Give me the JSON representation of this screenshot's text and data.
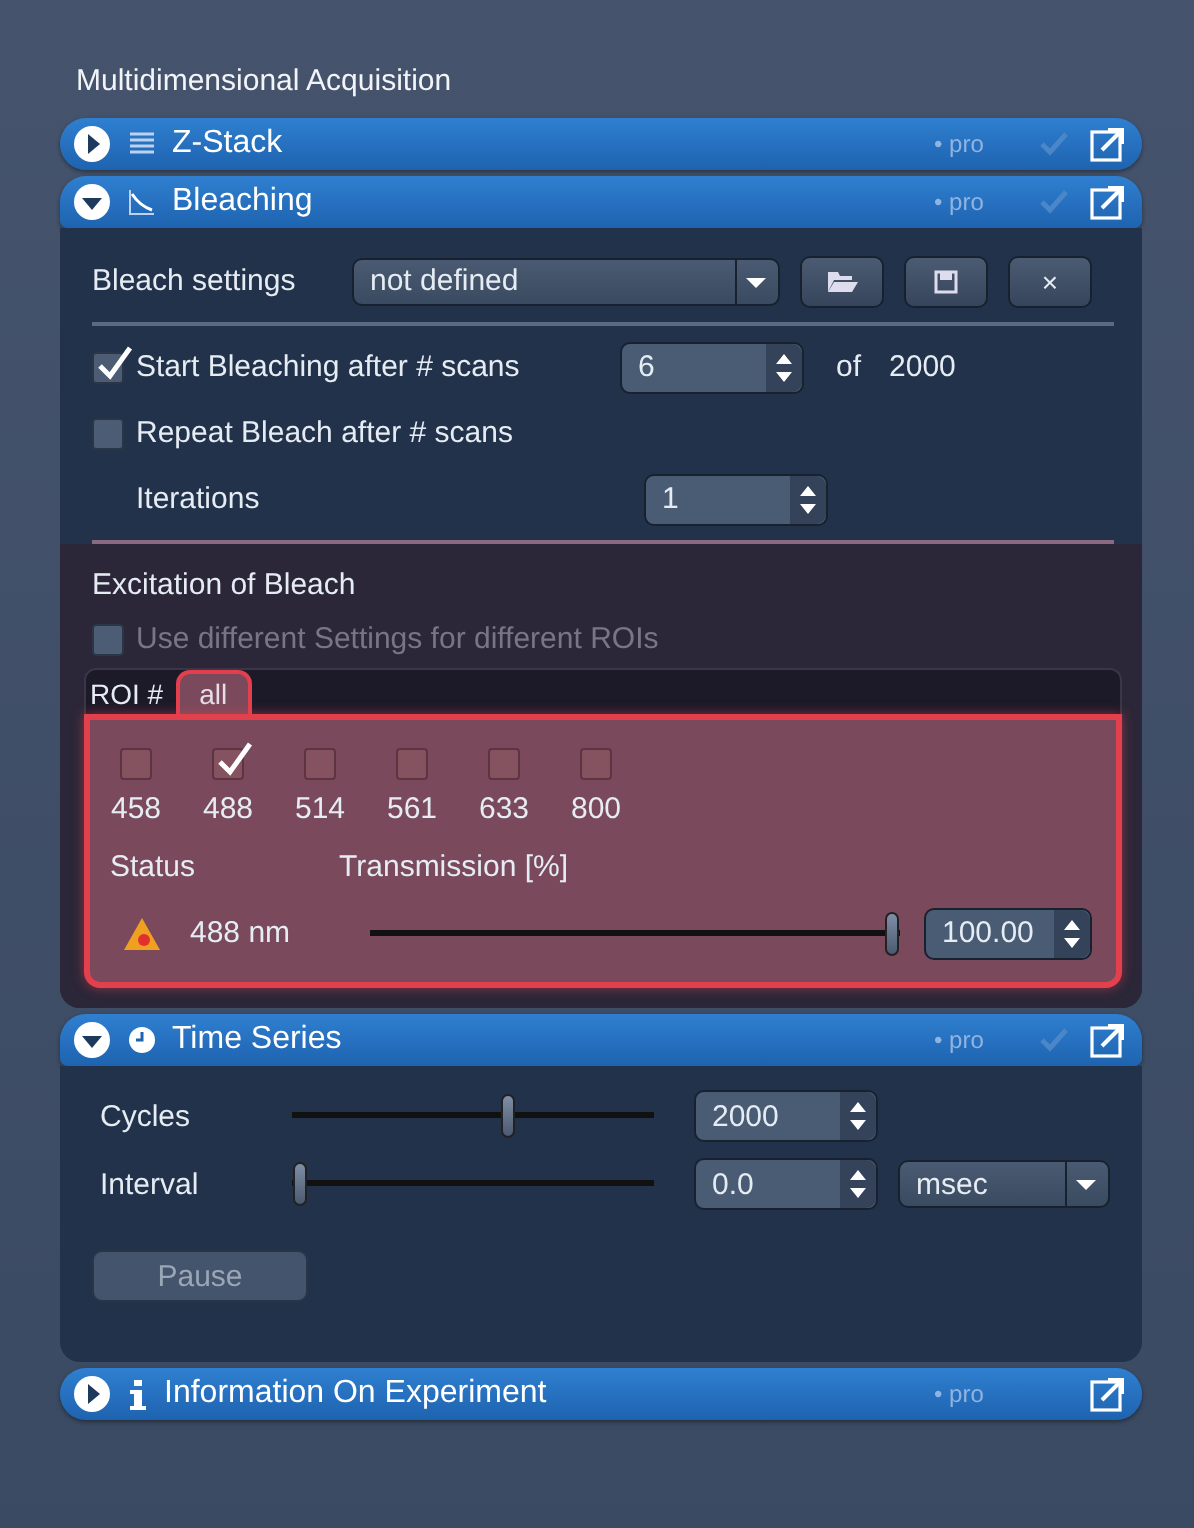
{
  "title": "Multidimensional Acquisition",
  "sections": [
    {
      "kind": "zstack",
      "title": "Z-Stack",
      "expanded": false,
      "badge": "• pro",
      "checked": true
    },
    {
      "kind": "bleaching",
      "title": "Bleaching",
      "expanded": true,
      "badge": "• pro",
      "checked": true,
      "settings": {
        "label": "Bleach settings",
        "value": "not defined",
        "clear": "×"
      },
      "start": {
        "label": "Start Bleaching after # scans",
        "checked": true,
        "value": "6",
        "of": "of",
        "total": "2000"
      },
      "repeat": {
        "label": "Repeat Bleach after # scans",
        "checked": false
      },
      "iterations": {
        "label": "Iterations",
        "value": "1"
      },
      "excitation": {
        "title": "Excitation of Bleach",
        "different": {
          "label": "Use different Settings for different ROIs",
          "checked": false,
          "disabled": true
        },
        "roi_label": "ROI #",
        "tabs": [
          {
            "label": "all",
            "selected": true
          }
        ],
        "lasers": [
          {
            "label": "458",
            "checked": false
          },
          {
            "label": "488",
            "checked": true
          },
          {
            "label": "514",
            "checked": false
          },
          {
            "label": "561",
            "checked": false
          },
          {
            "label": "633",
            "checked": false
          },
          {
            "label": "800",
            "checked": false
          }
        ],
        "status_label": "Status",
        "transmission_label": "Transmission [%]",
        "channels": [
          {
            "name": "488 nm",
            "level": 1.0,
            "value": "100.00"
          }
        ]
      }
    },
    {
      "kind": "timeseries",
      "title": "Time Series",
      "expanded": true,
      "badge": "• pro",
      "checked": true,
      "rows": [
        {
          "label": "Cycles",
          "level": 0.6,
          "value": "2000"
        },
        {
          "label": "Interval",
          "level": 0.0,
          "value": "0.0",
          "unit": "msec"
        }
      ],
      "pause": {
        "label": "Pause",
        "disabled": true
      }
    },
    {
      "kind": "info",
      "title": "Information On Experiment",
      "expanded": false,
      "badge": "• pro",
      "checked": false
    }
  ]
}
